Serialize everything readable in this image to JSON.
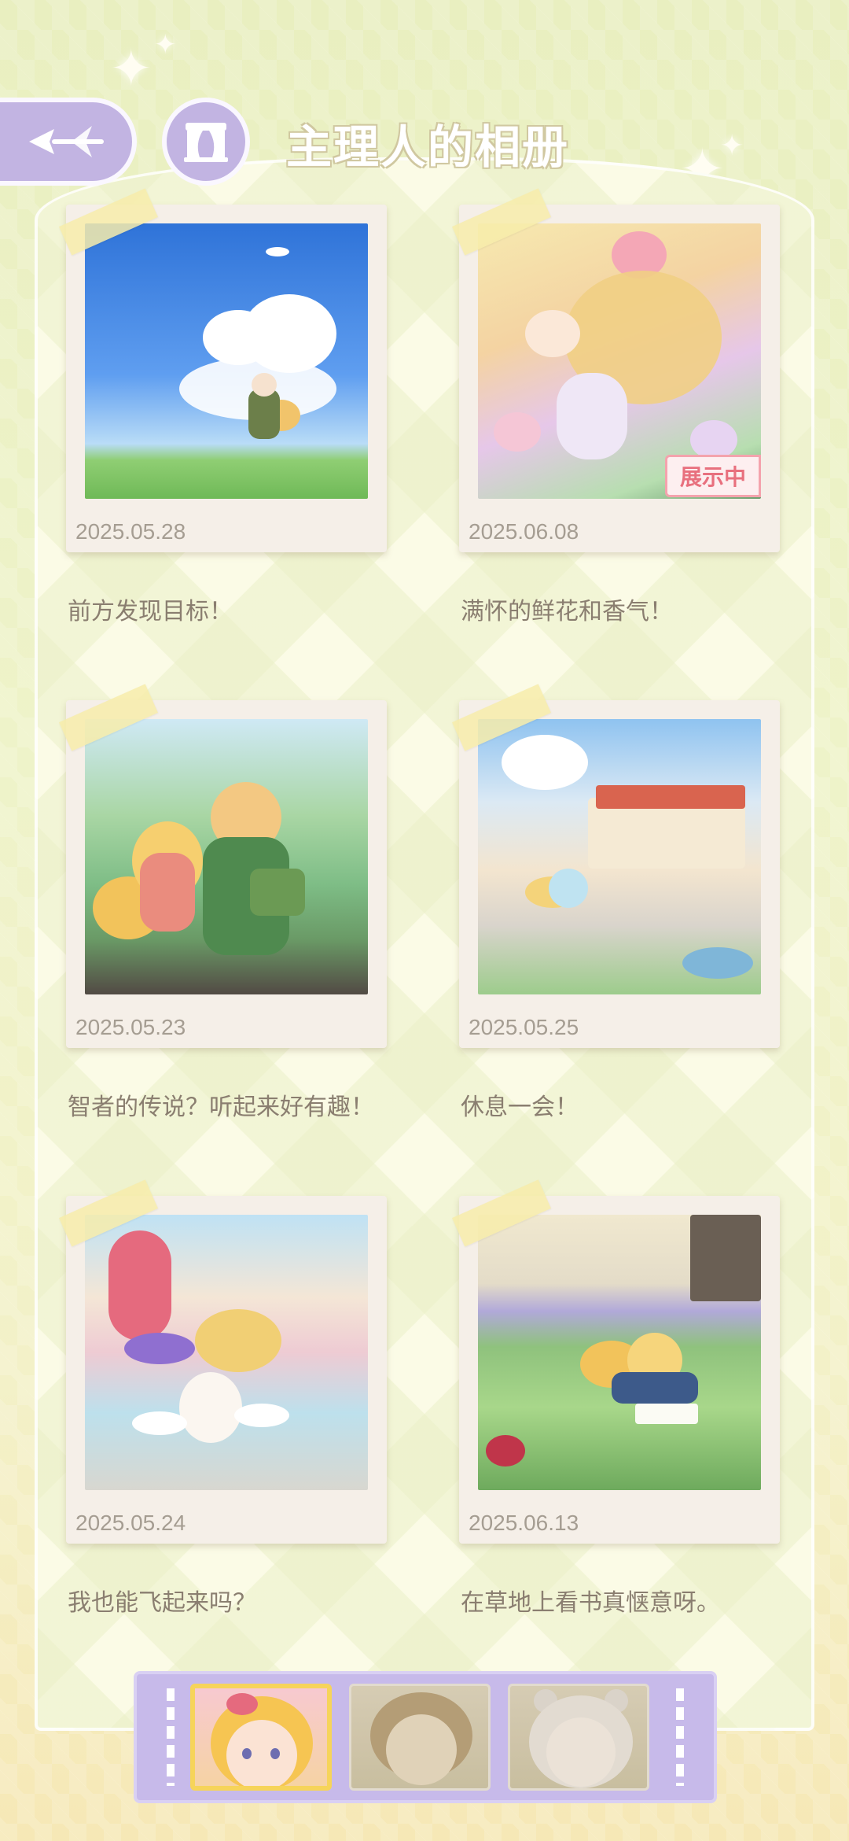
{
  "header": {
    "title": "主理人的相册",
    "back_icon": "winged-arrow-icon",
    "home_icon": "stage-curtain-icon"
  },
  "photos": [
    {
      "date": "2025.05.28",
      "caption": "前方发现目标！",
      "scene": "sky"
    },
    {
      "date": "2025.06.08",
      "caption": "满怀的鲜花和香气！",
      "scene": "flowers",
      "badge": "展示中"
    },
    {
      "date": "2025.05.23",
      "caption": "智者的传说？听起来好有趣！",
      "scene": "forest"
    },
    {
      "date": "2025.05.25",
      "caption": "休息一会！",
      "scene": "house"
    },
    {
      "date": "2025.05.24",
      "caption": "我也能飞起来吗？",
      "scene": "fountain"
    },
    {
      "date": "2025.06.13",
      "caption": "在草地上看书真惬意呀。",
      "scene": "lawn"
    }
  ],
  "characters": [
    {
      "name": "blonde-girl-portrait",
      "selected": true
    },
    {
      "name": "brown-hair-boy-portrait",
      "selected": false
    },
    {
      "name": "bear-ear-girl-portrait",
      "selected": false
    }
  ],
  "colors": {
    "accent_purple": "#c2b4e2",
    "badge_pink": "#e8707e",
    "selected_gold": "#f6d45a"
  }
}
